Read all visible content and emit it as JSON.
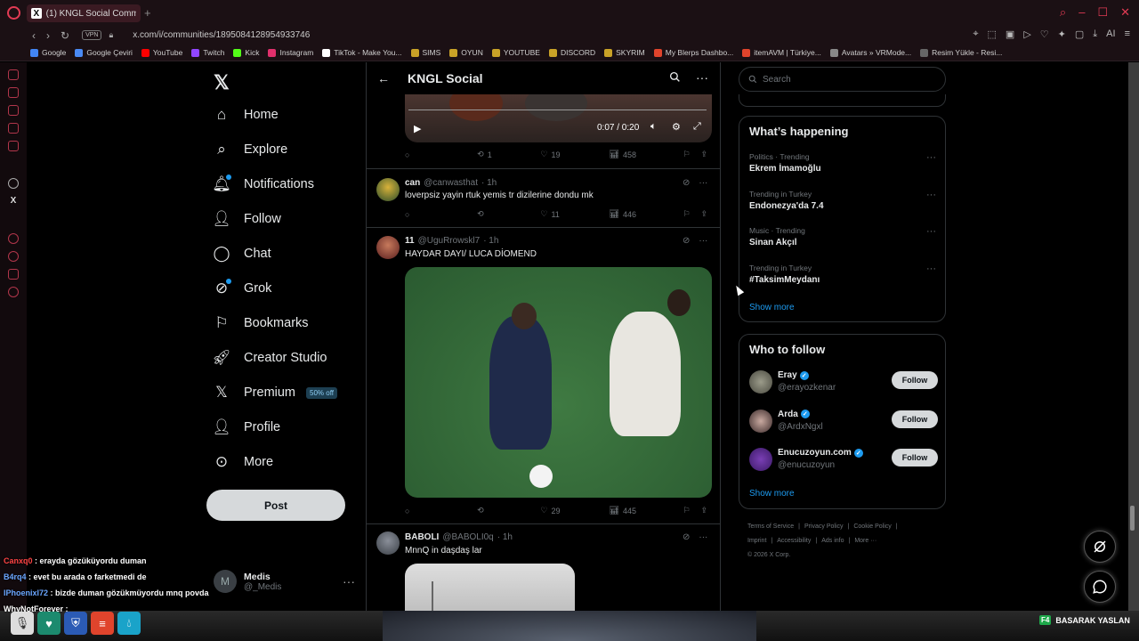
{
  "browser": {
    "tab_title": "(1) KNGL Social Comm",
    "url": "x.com/i/communities/1895084128954933746",
    "vpn": "VPN",
    "bookmarks": [
      "Google",
      "Google Çeviri",
      "YouTube",
      "Twitch",
      "Kick",
      "Instagram",
      "TikTok - Make You...",
      "SIMS",
      "OYUN",
      "YOUTUBE",
      "DISCORD",
      "SKYRIM",
      "My Blerps Dashbo...",
      "itemAVM | Türkiye...",
      "Avatars » VRMode...",
      "Resim Yükle - Resi..."
    ]
  },
  "nav": {
    "items": [
      {
        "label": "Home",
        "icon": "home-icon"
      },
      {
        "label": "Explore",
        "icon": "search-icon"
      },
      {
        "label": "Notifications",
        "icon": "bell-icon"
      },
      {
        "label": "Follow",
        "icon": "person-plus-icon"
      },
      {
        "label": "Chat",
        "icon": "chat-icon"
      },
      {
        "label": "Grok",
        "icon": "grok-icon"
      },
      {
        "label": "Bookmarks",
        "icon": "bookmark-icon"
      },
      {
        "label": "Creator Studio",
        "icon": "rocket-icon"
      },
      {
        "label": "Premium",
        "icon": "x-icon"
      },
      {
        "label": "Profile",
        "icon": "person-icon"
      },
      {
        "label": "More",
        "icon": "more-circle-icon"
      }
    ],
    "premium_badge": "50% off",
    "post_button": "Post",
    "account": {
      "initial": "M",
      "name": "Medis",
      "handle": "@_Medis"
    }
  },
  "feed": {
    "title": "KNGL Social",
    "video": {
      "time": "0:07 / 0:20"
    },
    "top_actions": {
      "reposts": "1",
      "likes": "19",
      "views": "458"
    },
    "posts": [
      {
        "name": "can",
        "handle": "@canwasthat",
        "time": "· 1h",
        "text": "loverpsiz yayin rtuk yemis tr dizilerine dondu mk",
        "replies": "",
        "reposts": "",
        "likes": "11",
        "views": "446"
      },
      {
        "name": "11",
        "handle": "@UguRrowskl7",
        "time": "· 1h",
        "text": "HAYDAR DAYI/ LUCA DİOMEND",
        "replies": "",
        "reposts": "",
        "likes": "29",
        "views": "445"
      },
      {
        "name": "BABOLI",
        "handle": "@BABOLI0q",
        "time": "· 1h",
        "text": "MnnQ in daşdaş lar"
      }
    ]
  },
  "right": {
    "search_placeholder": "Search",
    "happening_title": "What’s happening",
    "trends": [
      {
        "context": "Politics · Trending",
        "name": "Ekrem İmamoğlu"
      },
      {
        "context": "Trending in Turkey",
        "name": "Endonezya'da 7.4"
      },
      {
        "context": "Music · Trending",
        "name": "Sinan Akçıl"
      },
      {
        "context": "Trending in Turkey",
        "name": "#TaksimMeydanı"
      }
    ],
    "show_more": "Show more",
    "who_title": "Who to follow",
    "who": [
      {
        "name": "Eray",
        "handle": "@erayozkenar",
        "button": "Follow"
      },
      {
        "name": "Arda",
        "handle": "@ArdxNgxl",
        "button": "Follow"
      },
      {
        "name": "Enucuzoyun.com",
        "handle": "@enucuzoyun",
        "button": "Follow"
      }
    ],
    "footer_links": [
      "Terms of Service",
      "|",
      "Privacy Policy",
      "|",
      "Cookie Policy",
      "|",
      "Imprint",
      "|",
      "Accessibility",
      "|",
      "Ads info",
      "|",
      "More ···"
    ],
    "copyright": "© 2026 X Corp."
  },
  "overlay": {
    "chat": [
      {
        "user": "Canxq0",
        "text": " : erayda gözüküyordu duman",
        "color": "#ff4444"
      },
      {
        "user": "B4rq4",
        "text": " : evet bu arada o farketmedi de",
        "color": "#6aa6ff"
      },
      {
        "user": "IPhoenixl72",
        "text": " : bizde duman gözükmüyordu mnq povda",
        "color": "#6aa6ff"
      },
      {
        "user": "WhyNotForever",
        "text": " : ",
        "color": "#ffffff"
      }
    ],
    "f4_key": "F4",
    "f4_label": "BASARAK YASLAN"
  },
  "colors": {
    "accent": "#1d9bf0",
    "opera": "#e23b54",
    "border": "#2f3336"
  }
}
